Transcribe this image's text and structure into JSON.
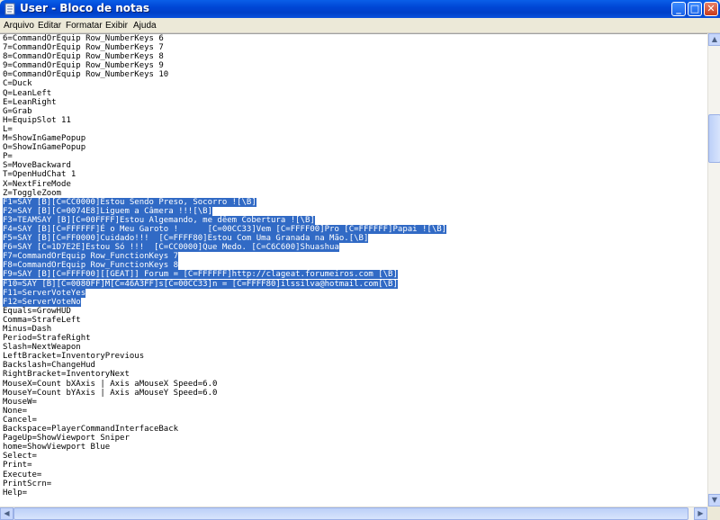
{
  "window": {
    "title": "User - Bloco de notas",
    "minimize": "_",
    "maximize": "□",
    "close": "✕"
  },
  "menu": [
    "Arquivo",
    "Editar",
    "Formatar",
    "Exibir",
    "Ajuda"
  ],
  "editor": {
    "lines": [
      {
        "text": "6=CommandOrEquip Row_NumberKeys 6",
        "selected": false
      },
      {
        "text": "7=CommandOrEquip Row_NumberKeys 7",
        "selected": false
      },
      {
        "text": "8=CommandOrEquip Row_NumberKeys 8",
        "selected": false
      },
      {
        "text": "9=CommandOrEquip Row_NumberKeys 9",
        "selected": false
      },
      {
        "text": "0=CommandOrEquip Row_NumberKeys 10",
        "selected": false
      },
      {
        "text": "C=Duck",
        "selected": false
      },
      {
        "text": "Q=LeanLeft",
        "selected": false
      },
      {
        "text": "E=LeanRight",
        "selected": false
      },
      {
        "text": "G=Grab",
        "selected": false
      },
      {
        "text": "H=EquipSlot 11",
        "selected": false
      },
      {
        "text": "L=",
        "selected": false
      },
      {
        "text": "M=ShowInGamePopup",
        "selected": false
      },
      {
        "text": "O=ShowInGamePopup",
        "selected": false
      },
      {
        "text": "P=",
        "selected": false
      },
      {
        "text": "S=MoveBackward",
        "selected": false
      },
      {
        "text": "T=OpenHudChat 1",
        "selected": false
      },
      {
        "text": "X=NextFireMode",
        "selected": false
      },
      {
        "text": "Z=ToggleZoom",
        "selected": false
      },
      {
        "text": "F1=SAY [B][C=CC0000]Estou Sendo Preso, Socorro ![\\B]",
        "selected": true
      },
      {
        "text": "F2=SAY [B][C=0074E8]Liguem a Câmera !!![\\B]",
        "selected": true
      },
      {
        "text": "F3=TEAMSAY [B][C=00FFFF]Estou Algemando, me dêem Cobertura ![\\B]",
        "selected": true
      },
      {
        "text": "F4=SAY [B][C=FFFFFF]É o Meu Garoto !      [C=00CC33]Vem [C=FFFF00]Pro [C=FFFFFF]Papai ![\\B]",
        "selected": true
      },
      {
        "text": "F5=SAY [B][C=FF0000]Cuidado!!!  [C=FFFF80]Estou Com Uma Granada na Mão.[\\B]",
        "selected": true
      },
      {
        "text": "F6=SAY [C=1D7E2E]Estou Só !!!  [C=CC0000]Que Medo. [C=C6C600]Shuashua",
        "selected": true
      },
      {
        "text": "F7=CommandOrEquip Row_FunctionKeys 7",
        "selected": true
      },
      {
        "text": "F8=CommandOrEquip Row_FunctionKeys 8",
        "selected": true
      },
      {
        "text": "F9=SAY [B][C=FFFF00][[GEAT]] Forum = [C=FFFFFF]http://clageat.forumeiros.com [\\B]",
        "selected": true
      },
      {
        "text": "F10=SAY [B][C=0080FF]M[C=46A3FF]s[C=00CC33]n = [C=FFFF80]ilssilva@hotmail.com[\\B]",
        "selected": true
      },
      {
        "text": "F11=ServerVoteYes",
        "selected": true
      },
      {
        "text": "F12=ServerVoteNo",
        "selected": true
      },
      {
        "text": "Equals=GrowHUD",
        "selected": false
      },
      {
        "text": "Comma=StrafeLeft",
        "selected": false
      },
      {
        "text": "Minus=Dash",
        "selected": false
      },
      {
        "text": "Period=StrafeRight",
        "selected": false
      },
      {
        "text": "Slash=NextWeapon",
        "selected": false
      },
      {
        "text": "LeftBracket=InventoryPrevious",
        "selected": false
      },
      {
        "text": "Backslash=ChangeHud",
        "selected": false
      },
      {
        "text": "RightBracket=InventoryNext",
        "selected": false
      },
      {
        "text": "MouseX=Count bXAxis | Axis aMouseX Speed=6.0",
        "selected": false
      },
      {
        "text": "MouseY=Count bYAxis | Axis aMouseY Speed=6.0",
        "selected": false
      },
      {
        "text": "MouseW=",
        "selected": false
      },
      {
        "text": "None=",
        "selected": false
      },
      {
        "text": "Cancel=",
        "selected": false
      },
      {
        "text": "Backspace=PlayerCommandInterfaceBack",
        "selected": false
      },
      {
        "text": "PageUp=ShowViewport Sniper",
        "selected": false
      },
      {
        "text": "home=ShowViewport Blue",
        "selected": false
      },
      {
        "text": "Select=",
        "selected": false
      },
      {
        "text": "Print=",
        "selected": false
      },
      {
        "text": "Execute=",
        "selected": false
      },
      {
        "text": "PrintScrn=",
        "selected": false
      },
      {
        "text": "Help=",
        "selected": false
      }
    ]
  },
  "colors": {
    "selection": "#316ac5",
    "titlebar": "#0046d5"
  },
  "icons": {
    "app": "notepad-icon",
    "scroll_up": "▲",
    "scroll_down": "▼",
    "scroll_left": "◀",
    "scroll_right": "▶"
  }
}
